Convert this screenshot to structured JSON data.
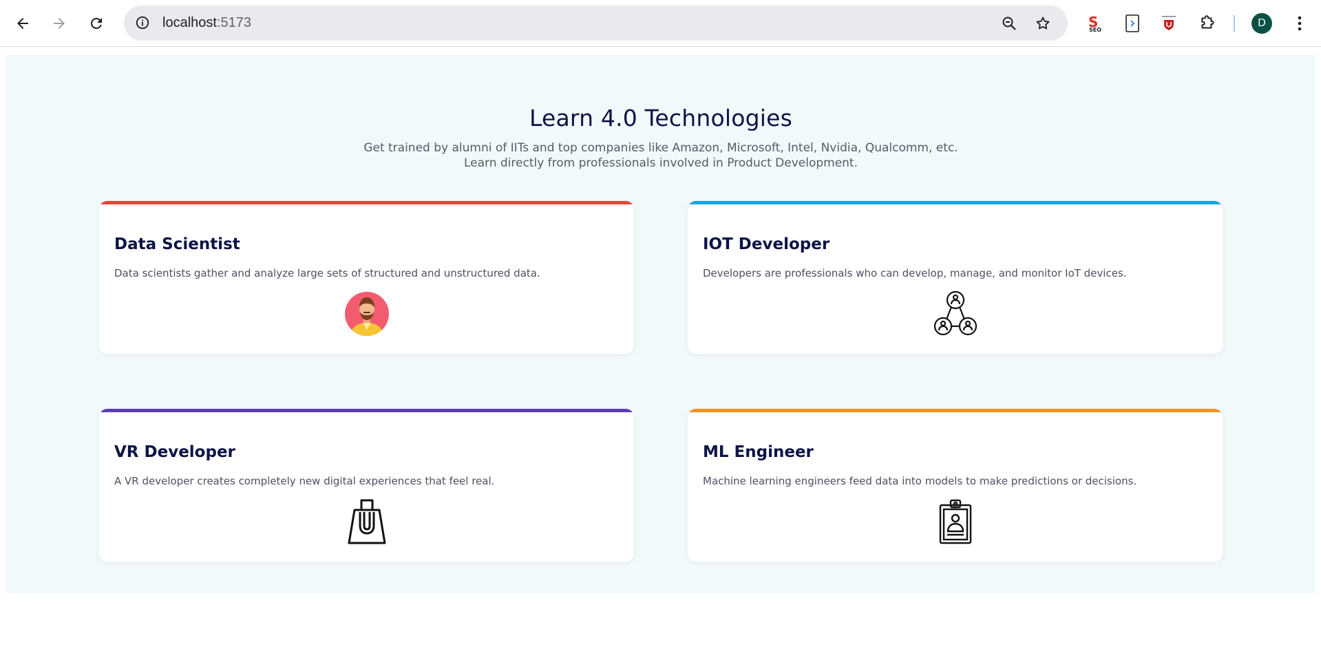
{
  "browser": {
    "url_host": "localhost",
    "url_port": ":5173",
    "profile_initial": "D",
    "extensions": [
      "seo-extension-icon",
      "document-extension-icon",
      "shield-extension-icon",
      "puzzle-extensions-icon"
    ],
    "seo_label": "SEO"
  },
  "hero": {
    "title": "Learn 4.0 Technologies",
    "subtitle_line1": "Get trained by alumni of IITs and top companies like Amazon, Microsoft, Intel, Nvidia, Qualcomm, etc.",
    "subtitle_line2": "Learn directly from professionals involved in Product Development."
  },
  "cards": [
    {
      "title": "Data Scientist",
      "description": "Data scientists gather and analyze large sets of structured and unstructured data.",
      "accent": "#ea4335",
      "icon": "data-scientist-avatar-icon"
    },
    {
      "title": "IOT Developer",
      "description": "Developers are professionals who can develop, manage, and monitor IoT devices.",
      "accent": "#13a6e6",
      "icon": "network-users-icon"
    },
    {
      "title": "VR Developer",
      "description": "A VR developer creates completely new digital experiences that feel real.",
      "accent": "#5c3bb3",
      "icon": "magnet-bag-icon"
    },
    {
      "title": "ML Engineer",
      "description": "Machine learning engineers feed data into models to make predictions or decisions.",
      "accent": "#f5921e",
      "icon": "id-badge-icon"
    }
  ],
  "colors": {
    "page_bg": "#f2f9fb",
    "heading": "#0b1446",
    "avatar_bg": "#0b5143"
  }
}
